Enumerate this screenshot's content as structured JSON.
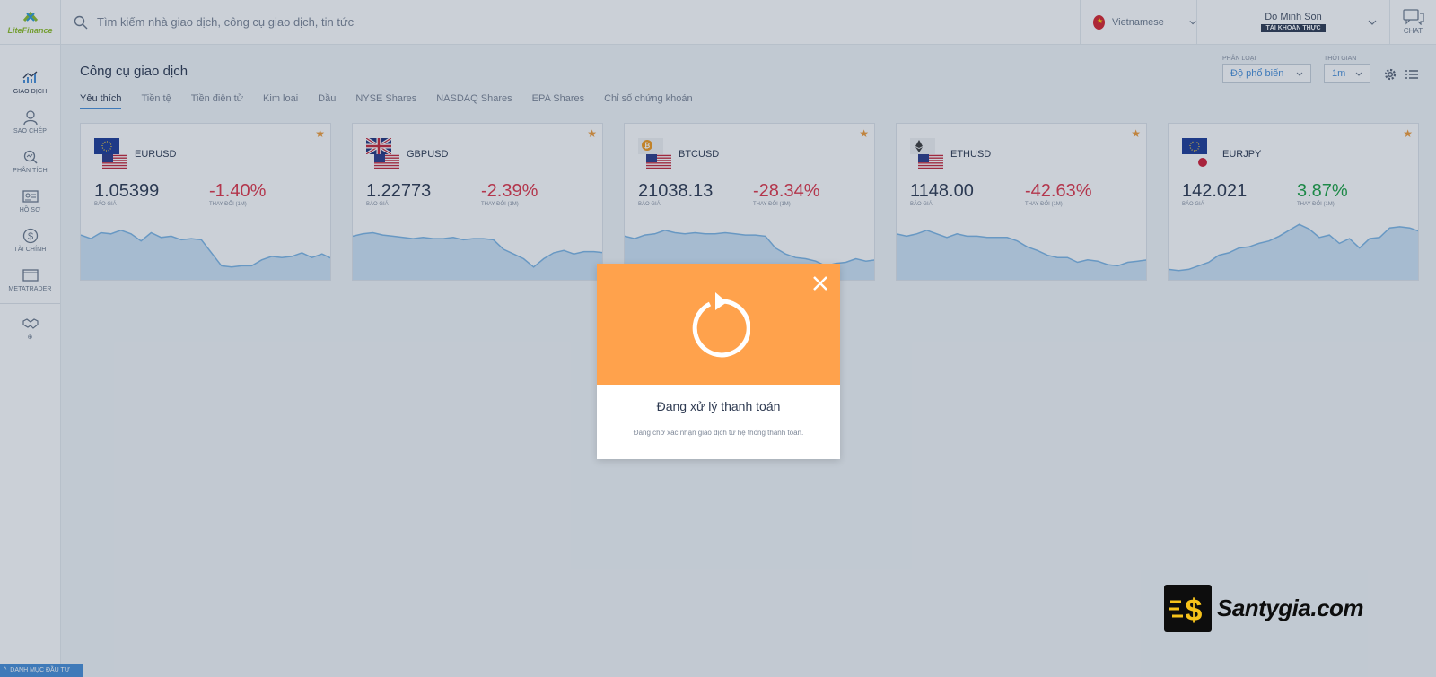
{
  "app": {
    "logo_text_a": "Lite",
    "logo_text_b": "Finance",
    "brand_color": "#8fbf2a"
  },
  "sidebar": {
    "items": [
      {
        "label": "GIAO DỊCH",
        "icon": "trading-chart-icon",
        "active": true
      },
      {
        "label": "SAO CHÉP",
        "icon": "copy-trader-icon"
      },
      {
        "label": "PHÂN TÍCH",
        "icon": "analysis-icon"
      },
      {
        "label": "HỒ SƠ",
        "icon": "profile-card-icon"
      },
      {
        "label": "TÀI CHÍNH",
        "icon": "dollar-icon"
      },
      {
        "label": "METATRADER",
        "icon": "monitor-icon"
      },
      {
        "label": "",
        "icon": "handshake-icon"
      }
    ],
    "bottom_tag": "DANH MỤC ĐẦU TƯ"
  },
  "search": {
    "placeholder": "Tìm kiếm nhà giao dịch, công cụ giao dịch, tin tức"
  },
  "language": {
    "label": "Vietnamese"
  },
  "user": {
    "name": "Do Minh Son",
    "account_type": "TÀI KHOẢN THỰC"
  },
  "chat": {
    "label": "CHAT"
  },
  "main": {
    "title": "Công cụ giao dịch",
    "tabs": [
      {
        "label": "Yêu thích",
        "active": true
      },
      {
        "label": "Tiền tệ"
      },
      {
        "label": "Tiền điện tử"
      },
      {
        "label": "Kim loại"
      },
      {
        "label": "Dầu"
      },
      {
        "label": "NYSE Shares"
      },
      {
        "label": "NASDAQ Shares"
      },
      {
        "label": "EPA Shares"
      },
      {
        "label": "Chỉ số chứng khoán"
      }
    ],
    "filters": {
      "category_label": "PHÂN LOẠI",
      "category_value": "Độ phổ biến",
      "time_label": "THỜI GIAN",
      "time_value": "1m"
    },
    "price_label": "BÁO GIÁ",
    "change_label": "THAY ĐỔI (1M)",
    "instruments": [
      {
        "pair": "EURUSD",
        "price": "1.05399",
        "change": "-1.40%",
        "direction": "neg",
        "flags": [
          "eu",
          "us"
        ],
        "spark": [
          0.68,
          0.62,
          0.72,
          0.7,
          0.76,
          0.7,
          0.58,
          0.72,
          0.64,
          0.66,
          0.6,
          0.62,
          0.6,
          0.38,
          0.16,
          0.14,
          0.16,
          0.16,
          0.26,
          0.32,
          0.3,
          0.32,
          0.38,
          0.3,
          0.36,
          0.28
        ]
      },
      {
        "pair": "GBPUSD",
        "price": "1.22773",
        "change": "-2.39%",
        "direction": "neg",
        "flags": [
          "gb",
          "us"
        ],
        "spark": [
          0.66,
          0.7,
          0.72,
          0.68,
          0.66,
          0.64,
          0.62,
          0.64,
          0.62,
          0.62,
          0.64,
          0.6,
          0.62,
          0.62,
          0.6,
          0.44,
          0.36,
          0.28,
          0.14,
          0.28,
          0.38,
          0.42,
          0.36,
          0.4,
          0.4,
          0.38
        ]
      },
      {
        "pair": "BTCUSD",
        "price": "21038.13",
        "change": "-28.34%",
        "direction": "neg",
        "flags": [
          "btc",
          "us"
        ],
        "spark": [
          0.66,
          0.62,
          0.68,
          0.7,
          0.76,
          0.72,
          0.7,
          0.72,
          0.7,
          0.7,
          0.72,
          0.7,
          0.68,
          0.68,
          0.66,
          0.46,
          0.36,
          0.3,
          0.28,
          0.24,
          0.16,
          0.2,
          0.22,
          0.28,
          0.24,
          0.26
        ]
      },
      {
        "pair": "ETHUSD",
        "price": "1148.00",
        "change": "-42.63%",
        "direction": "neg",
        "flags": [
          "eth",
          "us"
        ],
        "spark": [
          0.7,
          0.66,
          0.7,
          0.76,
          0.7,
          0.64,
          0.7,
          0.66,
          0.66,
          0.64,
          0.64,
          0.64,
          0.58,
          0.48,
          0.42,
          0.34,
          0.3,
          0.3,
          0.22,
          0.26,
          0.24,
          0.18,
          0.16,
          0.22,
          0.24,
          0.26
        ]
      },
      {
        "pair": "EURJPY",
        "price": "142.021",
        "change": "3.87%",
        "direction": "pos",
        "flags": [
          "eu",
          "jp"
        ],
        "spark": [
          0.1,
          0.08,
          0.1,
          0.16,
          0.22,
          0.34,
          0.38,
          0.46,
          0.48,
          0.54,
          0.58,
          0.66,
          0.76,
          0.86,
          0.78,
          0.64,
          0.68,
          0.54,
          0.62,
          0.46,
          0.62,
          0.64,
          0.8,
          0.82,
          0.8,
          0.74
        ]
      }
    ]
  },
  "modal": {
    "title": "Đang xử lý thanh toán",
    "subtitle": "Đang chờ xác nhận giao dịch từ hệ thống thanh toán.",
    "header_color": "#ffa24c"
  },
  "watermark": {
    "text": "Santygia.com"
  },
  "colors": {
    "accent": "#4a90d9",
    "negative": "#e0374b",
    "positive": "#1ea346",
    "star": "#f19c3a",
    "spark_fill": "#cfe4f6",
    "spark_line": "#7fb7e6"
  }
}
